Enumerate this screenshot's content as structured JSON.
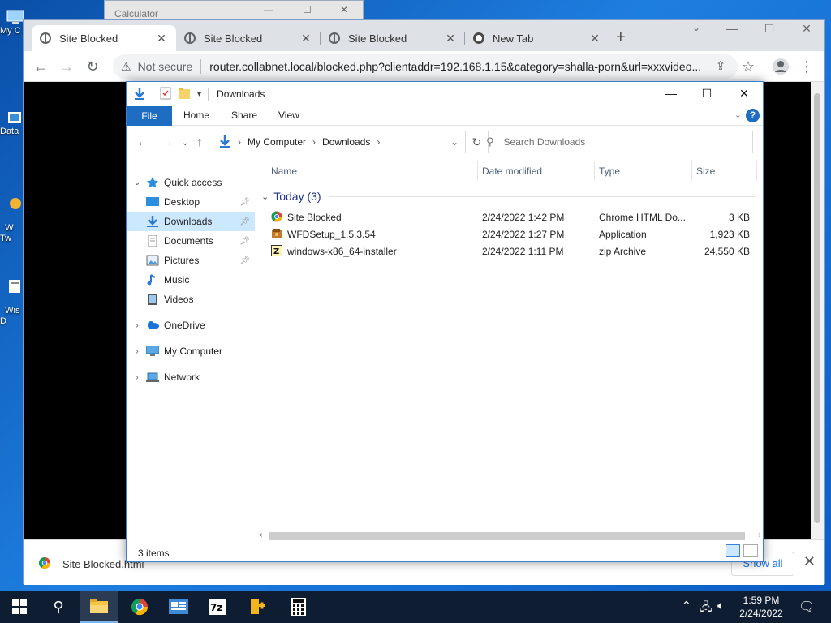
{
  "desktop": {
    "icons": [
      {
        "label": "My C",
        "icon": "computer-icon"
      },
      {
        "label": "Data",
        "icon": "shortcut-icon"
      },
      {
        "label": "W\nTw",
        "icon": "shortcut-icon"
      },
      {
        "label": "Wis\nD",
        "icon": "shortcut-icon"
      }
    ]
  },
  "calculator": {
    "title": "Calculator"
  },
  "chrome": {
    "tabs": [
      {
        "label": "Site Blocked",
        "icon": "globe-icon",
        "active": true
      },
      {
        "label": "Site Blocked",
        "icon": "globe-icon",
        "active": false
      },
      {
        "label": "Site Blocked",
        "icon": "globe-icon",
        "active": false
      },
      {
        "label": "New Tab",
        "icon": "chrome-icon",
        "active": false
      }
    ],
    "new_tab_symbol": "+",
    "not_secure": "Not secure",
    "url": "router.collabnet.local/blocked.php?clientaddr=192.168.1.15&category=shalla-porn&url=xxxvideo...",
    "download": {
      "filename": "Site Blocked.html",
      "show_all": "Show all"
    }
  },
  "explorer": {
    "title": "Downloads",
    "ribbon": {
      "file": "File",
      "home": "Home",
      "share": "Share",
      "view": "View",
      "help": "?"
    },
    "breadcrumb": [
      "My Computer",
      "Downloads"
    ],
    "search_placeholder": "Search Downloads",
    "nav": {
      "quick_access": "Quick access",
      "items": [
        {
          "label": "Desktop",
          "icon": "desktop-icon",
          "pinned": true
        },
        {
          "label": "Downloads",
          "icon": "download-icon",
          "pinned": true,
          "selected": true
        },
        {
          "label": "Documents",
          "icon": "document-icon",
          "pinned": true
        },
        {
          "label": "Pictures",
          "icon": "pictures-icon",
          "pinned": true
        },
        {
          "label": "Music",
          "icon": "music-icon",
          "pinned": false
        },
        {
          "label": "Videos",
          "icon": "video-icon",
          "pinned": false
        }
      ],
      "onedrive": "OneDrive",
      "my_computer": "My Computer",
      "network": "Network"
    },
    "columns": {
      "name": "Name",
      "date": "Date modified",
      "type": "Type",
      "size": "Size"
    },
    "group": "Today (3)",
    "files": [
      {
        "name": "Site Blocked",
        "date": "2/24/2022 1:42 PM",
        "type": "Chrome HTML Do...",
        "size": "3 KB",
        "icon": "chrome-file-icon"
      },
      {
        "name": "WFDSetup_1.5.3.54",
        "date": "2/24/2022 1:27 PM",
        "type": "Application",
        "size": "1,923 KB",
        "icon": "installer-icon"
      },
      {
        "name": "windows-x86_64-installer",
        "date": "2/24/2022 1:11 PM",
        "type": "zip Archive",
        "size": "24,550 KB",
        "icon": "zip-icon"
      }
    ],
    "status": "3 items"
  },
  "taskbar": {
    "apps": [
      "file-explorer-icon",
      "chrome-icon",
      "network-app-icon",
      "7zip-icon",
      "notepad-plus-icon",
      "calculator-icon"
    ],
    "time": "1:59 PM",
    "date": "2/24/2022"
  },
  "colors": {
    "accent": "#1f6dc0",
    "selection": "#cce8ff",
    "taskbar": "#0f1d33"
  }
}
